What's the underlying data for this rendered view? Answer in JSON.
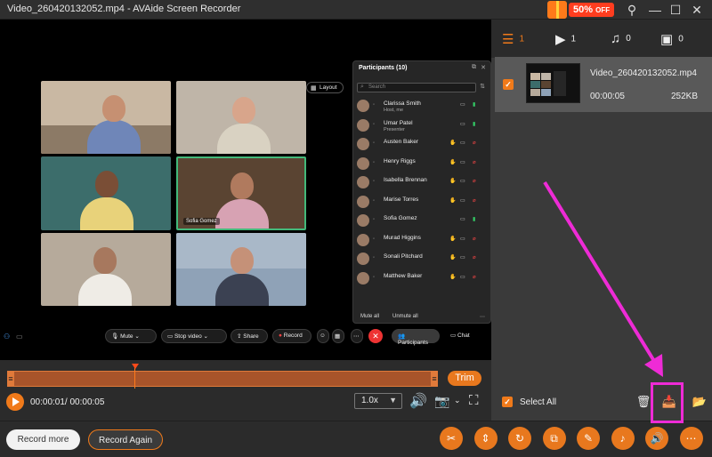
{
  "window": {
    "title": "Video_260420132052.mp4  -  AVAide Screen Recorder",
    "promo": {
      "percent": "50%",
      "text": "OFF"
    },
    "controls": {
      "pin": "⚲",
      "minimize": "—",
      "maximize": "☐",
      "close": "✕"
    }
  },
  "recording": {
    "meeting": {
      "zoom_level": 0.45,
      "layout_label": "Layout",
      "tile_label": "Sofia Gomez",
      "participants_title": "Participants (10)",
      "search_placeholder": "Search",
      "participants": [
        {
          "name": "Clarissa Smith",
          "role": "Host, me",
          "muted": false
        },
        {
          "name": "Umar Patel",
          "role": "Presenter",
          "muted": false
        },
        {
          "name": "Austen Baker",
          "role": "",
          "muted": true
        },
        {
          "name": "Henry Riggs",
          "role": "",
          "muted": true
        },
        {
          "name": "Isabella Brennan",
          "role": "",
          "muted": true
        },
        {
          "name": "Marise Torres",
          "role": "",
          "muted": true
        },
        {
          "name": "Sofia Gomez",
          "role": "",
          "muted": false
        },
        {
          "name": "Murad Higgins",
          "role": "",
          "muted": true
        },
        {
          "name": "Sonali Pitchard",
          "role": "",
          "muted": true
        },
        {
          "name": "Matthew Baker",
          "role": "",
          "muted": true
        }
      ],
      "mute_all": "Mute all",
      "unmute_all": "Unmute all",
      "controls": {
        "mute": "Mute",
        "stop_video": "Stop video",
        "share": "Share",
        "record": "Record",
        "participants": "Participants",
        "chat": "Chat"
      }
    }
  },
  "player": {
    "trim_label": "Trim",
    "time": "00:00:01/ 00:00:05",
    "speed": "1.0x"
  },
  "library": {
    "tabs": [
      {
        "icon": "list-icon",
        "glyph": "☰",
        "count": "1"
      },
      {
        "icon": "video-icon",
        "glyph": "▶",
        "count": "1"
      },
      {
        "icon": "music-icon",
        "glyph": "♫",
        "count": "0"
      },
      {
        "icon": "image-icon",
        "glyph": "▣",
        "count": "0"
      }
    ],
    "file": {
      "name": "Video_260420132052.mp4",
      "duration": "00:00:05",
      "size": "252KB",
      "checked": true
    },
    "select_all": "Select All"
  },
  "footer": {
    "record_more": "Record more",
    "record_again": "Record Again",
    "tools": [
      {
        "icon": "scissors-icon",
        "glyph": "✂"
      },
      {
        "icon": "compress-icon",
        "glyph": "⇕"
      },
      {
        "icon": "rotate-icon",
        "glyph": "↻"
      },
      {
        "icon": "merge-icon",
        "glyph": "⧉"
      },
      {
        "icon": "edit-icon",
        "glyph": "✎"
      },
      {
        "icon": "audio-convert-icon",
        "glyph": "♪"
      },
      {
        "icon": "volume-boost-icon",
        "glyph": "🔊"
      },
      {
        "icon": "more-icon",
        "glyph": "⋯"
      }
    ]
  },
  "colors": {
    "accent": "#f07a1a",
    "highlight": "#ee2bd6",
    "timeline": "#a8542a"
  }
}
